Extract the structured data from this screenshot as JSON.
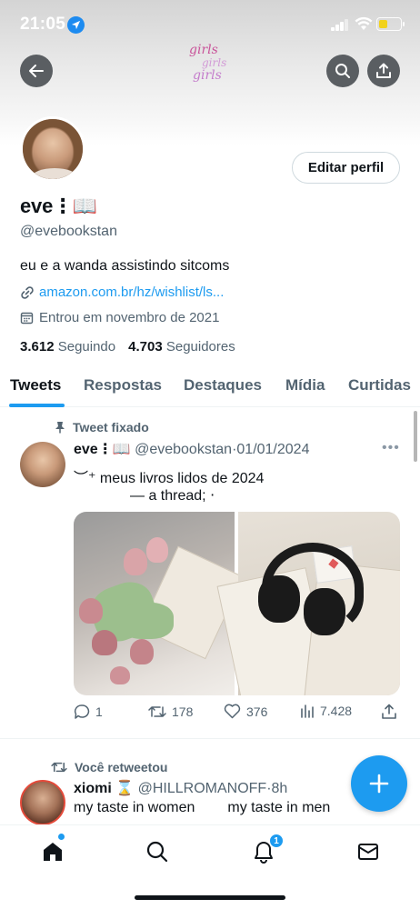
{
  "status_bar": {
    "time": "21:05"
  },
  "header": {
    "logo_lines": [
      "girls",
      "girls",
      "girls"
    ]
  },
  "profile": {
    "edit_label": "Editar perfil",
    "display_name": "eve⋮📖",
    "handle": "@evebookstan",
    "bio": "eu e a wanda assistindo sitcoms",
    "link": "amazon.com.br/hz/wishlist/ls...",
    "joined": "Entrou em novembro de 2021",
    "following_count": "3.612",
    "following_label": "Seguindo",
    "followers_count": "4.703",
    "followers_label": "Seguidores"
  },
  "tabs": [
    "Tweets",
    "Respostas",
    "Destaques",
    "Mídia",
    "Curtidas"
  ],
  "pinned_tweet": {
    "pinned_label": "Tweet fixado",
    "name": "eve⋮📖",
    "handle": "@evebookstan",
    "separator": "·",
    "date": "01/01/2024",
    "line1": "︶⁺ meus livros lidos de 2024",
    "line2": "— a thread; ⋅",
    "replies": "1",
    "retweets": "178",
    "likes": "376",
    "views": "7.428"
  },
  "retweet": {
    "label": "Você retweetou",
    "name": "xiomi ⌛",
    "handle": "@HILLROMANOFF",
    "separator": "·",
    "time": "8h",
    "text_left": "my taste in women",
    "text_right": "my taste in men"
  },
  "bottom_nav": {
    "notification_count": "1"
  },
  "colors": {
    "accent": "#1d9bf0",
    "text": "#0f1419",
    "muted": "#536471"
  }
}
